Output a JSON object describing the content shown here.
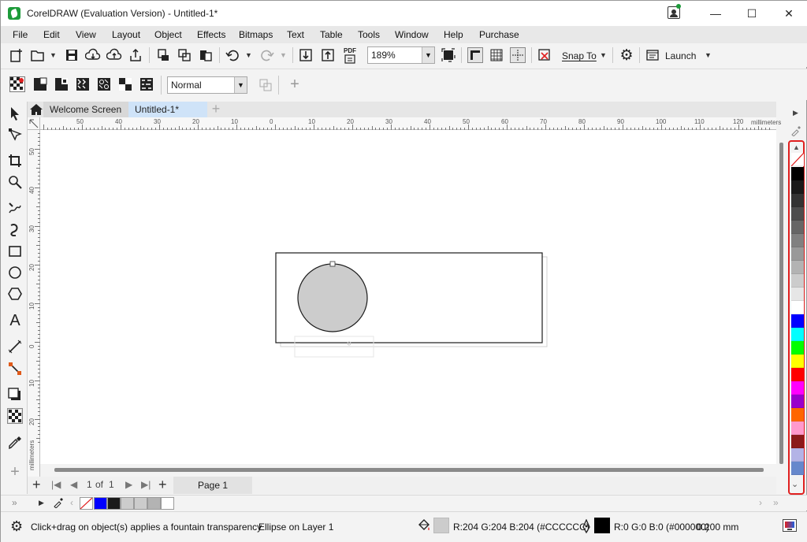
{
  "window": {
    "title": "CorelDRAW (Evaluation Version) - Untitled-1*",
    "minimize": "—",
    "maximize": "☐",
    "close": "✕"
  },
  "menu": [
    "File",
    "Edit",
    "View",
    "Layout",
    "Object",
    "Effects",
    "Bitmaps",
    "Text",
    "Table",
    "Tools",
    "Window",
    "Help",
    "Purchase"
  ],
  "standard_toolbar": {
    "zoom": "189%",
    "snap_to": "Snap To",
    "launch": "Launch",
    "pdf_label": "PDF"
  },
  "property_bar": {
    "merge_mode": "Normal"
  },
  "tabs": [
    {
      "label": "Welcome Screen",
      "active": false
    },
    {
      "label": "Untitled-1*",
      "active": true
    }
  ],
  "ruler": {
    "units": "millimeters",
    "h_labels": [
      "50",
      "40",
      "30",
      "20",
      "10",
      "0",
      "10",
      "20",
      "30",
      "40",
      "50",
      "60",
      "70",
      "80",
      "90",
      "100",
      "110",
      "120"
    ],
    "v_labels": [
      "50",
      "40",
      "30",
      "20",
      "10",
      "0",
      "10",
      "20"
    ]
  },
  "page_nav": {
    "current": "1",
    "of_label": "of",
    "total": "1",
    "page_tab": "Page 1"
  },
  "palette_colors": [
    "#000000",
    "#1a1a1a",
    "#333333",
    "#4d4d4d",
    "#666666",
    "#808080",
    "#999999",
    "#b3b3b3",
    "#cccccc",
    "#e6e6e6",
    "#ffffff",
    "#0000ff",
    "#00ffff",
    "#00ff00",
    "#ffff00",
    "#ff0000",
    "#ff00ff",
    "#9900cc",
    "#ff6600",
    "#ff99cc",
    "#8b1a1a",
    "#b3b3e6",
    "#6688cc"
  ],
  "doc_palette_colors": [
    "#0000ff",
    "#1a1a1a",
    "#cccccc",
    "#cccccc",
    "#b3b3b3",
    "#ffffff"
  ],
  "status": {
    "hint": "Click+drag on object(s) applies a fountain transparency",
    "selection": "Ellipse on Layer 1",
    "fill_value": "R:204 G:204 B:204 (#CCCCCC)",
    "fill_color": "#CCCCCC",
    "outline_value": "R:0 G:0 B:0 (#000000)",
    "outline_width": "0.200 mm",
    "outline_color": "#000000"
  }
}
